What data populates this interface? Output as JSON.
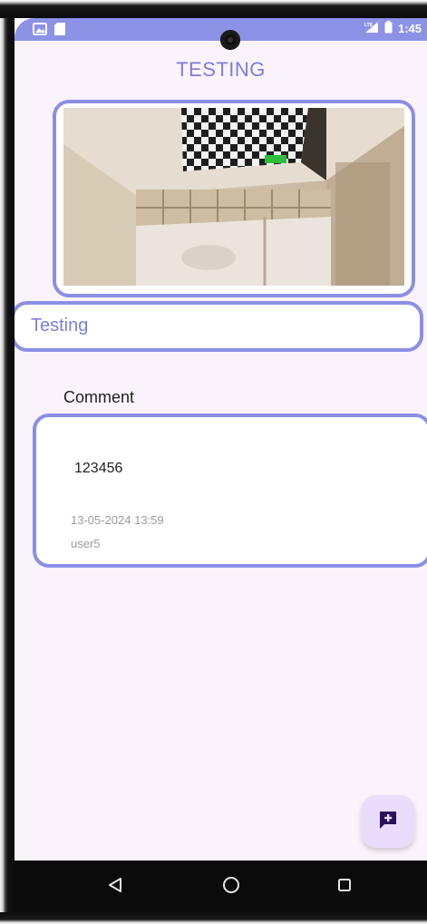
{
  "status_bar": {
    "time": "1:45",
    "icons": [
      "gallery-notification-icon",
      "sd-card-icon",
      "signal-icon",
      "battery-icon"
    ]
  },
  "header": {
    "title": "TESTING"
  },
  "photo": {
    "subject": "room-interior-with-checkerboard-ceiling"
  },
  "title_field": {
    "value": "Testing"
  },
  "comments": {
    "label": "Comment",
    "items": [
      {
        "text": "123456",
        "timestamp": "13-05-2024 13:59",
        "user": "user5"
      }
    ]
  },
  "fab": {
    "icon": "add-comment-icon"
  },
  "nav": {
    "back": "back-icon",
    "home": "home-icon",
    "recents": "recents-icon"
  },
  "colors": {
    "accent": "#8a8fe4",
    "status_bar": "#8c92e6",
    "background": "#fbf3fb",
    "fab": "#e9dcfb",
    "fab_icon": "#2a0f5c"
  }
}
